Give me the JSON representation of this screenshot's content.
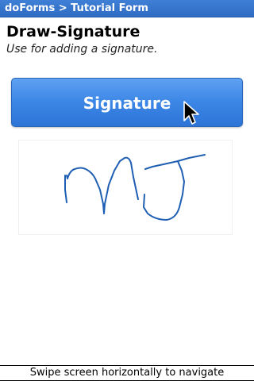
{
  "app": {
    "title": "doForms > Tutorial Form"
  },
  "field": {
    "label": "Draw-Signature",
    "hint": "Use for adding a signature."
  },
  "signature_button": {
    "label": "Signature"
  },
  "signature_pad": {
    "has_signature": true
  },
  "footer": {
    "hint": "Swipe screen horizontally to navigate"
  },
  "colors": {
    "titlebar": "#2f6cc4",
    "button": "#3b86e6",
    "ink": "#1f5fb3"
  },
  "icons": {
    "cursor": "arrow-cursor-icon"
  }
}
